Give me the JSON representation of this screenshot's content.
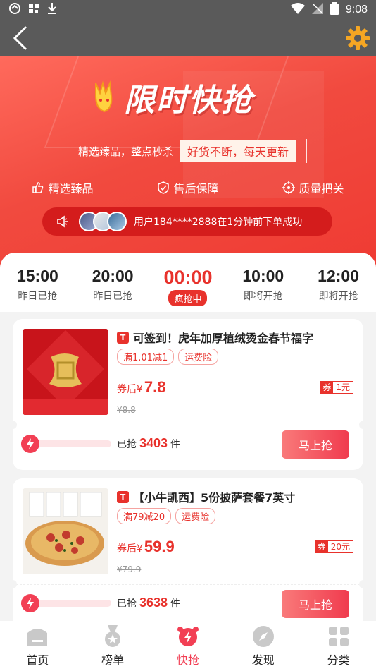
{
  "status_bar": {
    "time": "9:08"
  },
  "banner": {
    "title": "限时快抢",
    "slogan_left": "精选臻品，整点秒杀",
    "slogan_right": "好货不断，每天更新",
    "features": [
      "精选臻品",
      "售后保障",
      "质量把关"
    ],
    "ticker": "用户184****2888在1分钟前下单成功"
  },
  "time_slots": [
    {
      "time": "15:00",
      "label": "昨日已抢"
    },
    {
      "time": "20:00",
      "label": "昨日已抢"
    },
    {
      "time": "00:00",
      "label": "疯抢中"
    },
    {
      "time": "10:00",
      "label": "即将开抢"
    },
    {
      "time": "12:00",
      "label": "即将开抢"
    }
  ],
  "products": [
    {
      "title": "可签到！虎年加厚植绒烫金春节福字",
      "tag1": "满1.01减1",
      "tag2": "运费险",
      "price_label": "券后¥",
      "price": "7.8",
      "coupon_icon": "券",
      "coupon_value": "1元",
      "original_price": "¥8.8",
      "sold_label": "已抢",
      "sold_count": "3403",
      "sold_unit": "件",
      "buy_label": "马上抢",
      "progress": 0.18
    },
    {
      "title": "【小牛凯西】5份披萨套餐7英寸",
      "tag1": "满79减20",
      "tag2": "运费险",
      "price_label": "券后¥",
      "price": "59.9",
      "coupon_icon": "券",
      "coupon_value": "20元",
      "original_price": "¥79.9",
      "sold_label": "已抢",
      "sold_count": "3638",
      "sold_unit": "件",
      "buy_label": "马上抢",
      "progress": 0.12
    }
  ],
  "tmall_icon_text": "T",
  "bottom_nav": [
    {
      "label": "首页",
      "icon": "home-icon"
    },
    {
      "label": "榜单",
      "icon": "medal-icon"
    },
    {
      "label": "快抢",
      "icon": "alarm-bolt-icon"
    },
    {
      "label": "发现",
      "icon": "compass-icon"
    },
    {
      "label": "分类",
      "icon": "grid-icon"
    }
  ],
  "colors": {
    "accent": "#e8322c",
    "button": "#f03b4e",
    "banner": "#f14a3f",
    "topbar": "#5a5a5a"
  }
}
